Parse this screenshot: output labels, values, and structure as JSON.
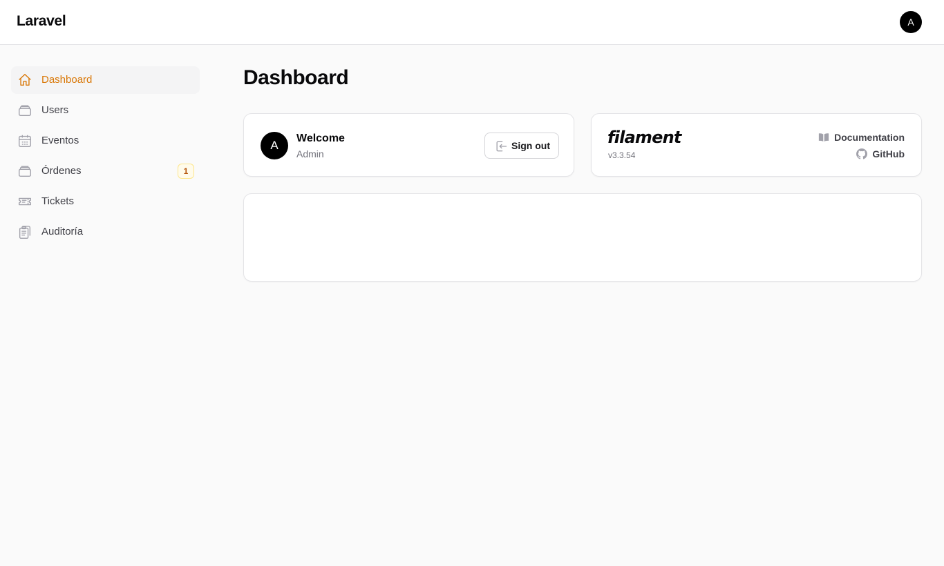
{
  "header": {
    "brand": "Laravel",
    "user_initial": "A"
  },
  "sidebar": {
    "items": [
      {
        "label": "Dashboard",
        "icon": "home-icon",
        "active": true
      },
      {
        "label": "Users",
        "icon": "stack-icon"
      },
      {
        "label": "Eventos",
        "icon": "calendar-icon"
      },
      {
        "label": "Órdenes",
        "icon": "stack-icon",
        "badge": "1"
      },
      {
        "label": "Tickets",
        "icon": "ticket-icon"
      },
      {
        "label": "Auditoría",
        "icon": "clipboard-icon"
      }
    ]
  },
  "main": {
    "title": "Dashboard",
    "welcome": {
      "avatar_initial": "A",
      "title": "Welcome",
      "name": "Admin",
      "signout_label": "Sign out"
    },
    "filament": {
      "logo": "filament",
      "version": "v3.3.54",
      "docs_label": "Documentation",
      "github_label": "GitHub"
    }
  },
  "colors": {
    "accent": "#d97706",
    "badge_bg": "#fffbeb",
    "badge_border": "#fde68a"
  }
}
